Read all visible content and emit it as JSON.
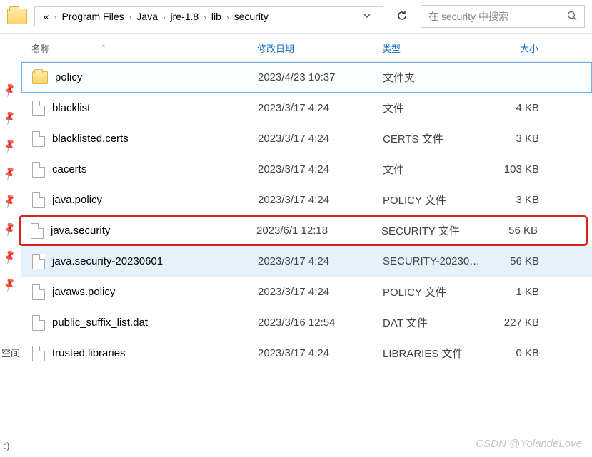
{
  "toolbar": {
    "breadcrumb_prefix": "«",
    "crumbs": [
      "Program Files",
      "Java",
      "jre-1.8",
      "lib",
      "security"
    ],
    "search_placeholder": "在 security 中搜索"
  },
  "columns": {
    "name": "名称",
    "date": "修改日期",
    "type": "类型",
    "size": "大小"
  },
  "files": [
    {
      "name": "policy",
      "date": "2023/4/23 10:37",
      "type": "文件夹",
      "size": "",
      "kind": "folder",
      "state": "outline"
    },
    {
      "name": "blacklist",
      "date": "2023/3/17 4:24",
      "type": "文件",
      "size": "4 KB",
      "kind": "file",
      "state": ""
    },
    {
      "name": "blacklisted.certs",
      "date": "2023/3/17 4:24",
      "type": "CERTS 文件",
      "size": "3 KB",
      "kind": "file",
      "state": ""
    },
    {
      "name": "cacerts",
      "date": "2023/3/17 4:24",
      "type": "文件",
      "size": "103 KB",
      "kind": "file",
      "state": ""
    },
    {
      "name": "java.policy",
      "date": "2023/3/17 4:24",
      "type": "POLICY 文件",
      "size": "3 KB",
      "kind": "file",
      "state": ""
    },
    {
      "name": "java.security",
      "date": "2023/6/1 12:18",
      "type": "SECURITY 文件",
      "size": "56 KB",
      "kind": "file",
      "state": "redbox"
    },
    {
      "name": "java.security-20230601",
      "date": "2023/3/17 4:24",
      "type": "SECURITY-20230…",
      "size": "56 KB",
      "kind": "file",
      "state": "fill"
    },
    {
      "name": "javaws.policy",
      "date": "2023/3/17 4:24",
      "type": "POLICY 文件",
      "size": "1 KB",
      "kind": "file",
      "state": ""
    },
    {
      "name": "public_suffix_list.dat",
      "date": "2023/3/16 12:54",
      "type": "DAT 文件",
      "size": "227 KB",
      "kind": "file",
      "state": ""
    },
    {
      "name": "trusted.libraries",
      "date": "2023/3/17 4:24",
      "type": "LIBRARIES 文件",
      "size": "0 KB",
      "kind": "file",
      "state": ""
    }
  ],
  "side": {
    "label": "空间",
    "smile": ":)"
  },
  "watermark": "CSDN @YolandeLove"
}
